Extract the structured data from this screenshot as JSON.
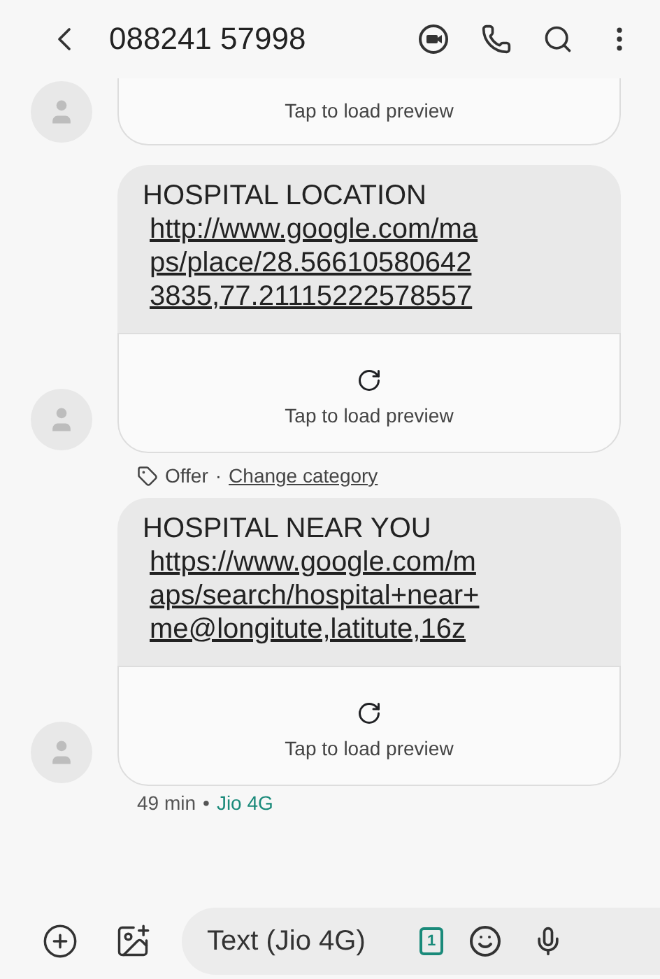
{
  "header": {
    "title": "088241 57998"
  },
  "messages": [
    {
      "kind": "preview",
      "preview": {
        "text": "Tap to load preview"
      }
    },
    {
      "kind": "link",
      "title": "HOSPITAL LOCATION",
      "url": "http://www.google.com/maps/place/28.566105806423835,77.21115222578557",
      "preview": {
        "text": "Tap to load preview"
      }
    },
    {
      "kind": "link",
      "label": {
        "category": "Offer",
        "separator": "·",
        "action": "Change category"
      },
      "title": "HOSPITAL NEAR YOU",
      "url": "https://www.google.com/maps/search/hospital+near+me@longitute,latitute,16z",
      "preview": {
        "text": "Tap to load preview"
      }
    }
  ],
  "status": {
    "time": "49 min",
    "separator": "•",
    "network": "Jio 4G"
  },
  "composer": {
    "placeholder": "Text (Jio 4G)",
    "sim": "1"
  }
}
